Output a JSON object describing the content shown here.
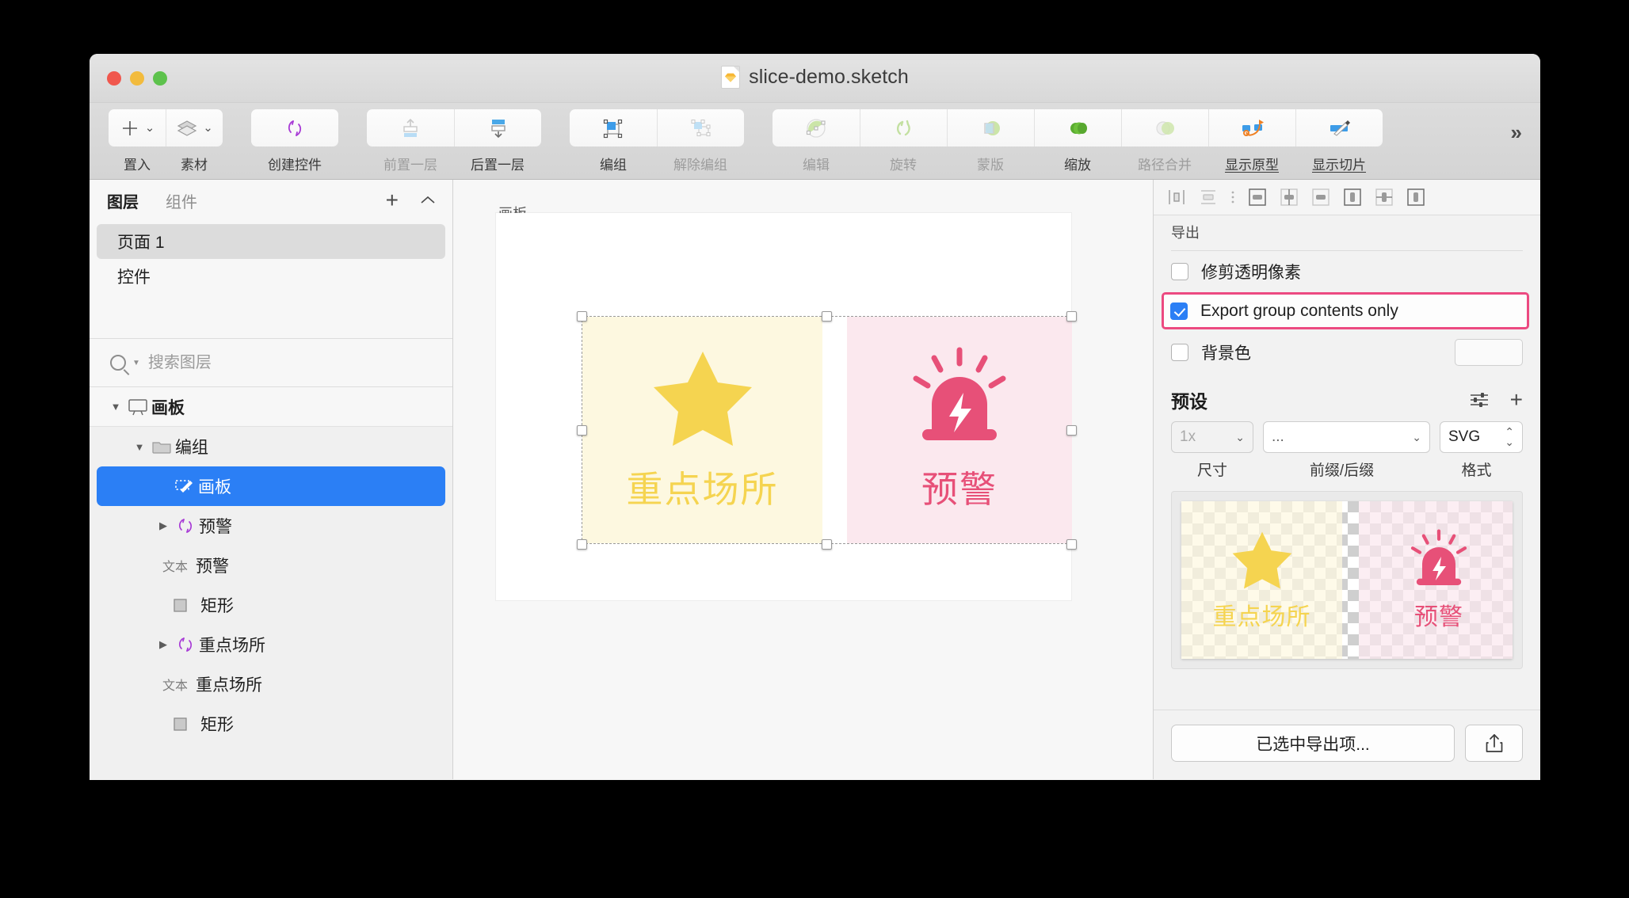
{
  "window": {
    "title": "slice-demo.sketch",
    "file_icon": "sketch-file-icon"
  },
  "toolbar": {
    "groups": [
      {
        "items": [
          {
            "label": "置入",
            "icon": "plus-icon",
            "dim": false,
            "underline": false,
            "chevron": true
          },
          {
            "label": "素材",
            "icon": "layers-stack-icon",
            "dim": false,
            "underline": false,
            "chevron": true
          }
        ]
      },
      {
        "items": [
          {
            "label": "创建控件",
            "icon": "symbol-refresh-icon",
            "dim": false,
            "underline": false,
            "chevron": false
          }
        ]
      },
      {
        "items": [
          {
            "label": "前置一层",
            "icon": "bring-forward-icon",
            "dim": true,
            "underline": false,
            "chevron": false
          },
          {
            "label": "后置一层",
            "icon": "send-backward-icon",
            "dim": false,
            "underline": false,
            "chevron": false
          }
        ]
      },
      {
        "items": [
          {
            "label": "编组",
            "icon": "group-icon",
            "dim": false,
            "underline": false,
            "chevron": false
          },
          {
            "label": "解除编组",
            "icon": "ungroup-icon",
            "dim": true,
            "underline": false,
            "chevron": false
          }
        ]
      },
      {
        "items": [
          {
            "label": "编辑",
            "icon": "edit-path-icon",
            "dim": true,
            "underline": false,
            "chevron": false
          },
          {
            "label": "旋转",
            "icon": "rotate-copies-icon",
            "dim": true,
            "underline": false,
            "chevron": false
          },
          {
            "label": "蒙版",
            "icon": "mask-icon",
            "dim": true,
            "underline": false,
            "chevron": false
          },
          {
            "label": "缩放",
            "icon": "scale-icon",
            "dim": false,
            "underline": false,
            "chevron": false
          },
          {
            "label": "路径合并",
            "icon": "union-paths-icon",
            "dim": true,
            "underline": false,
            "chevron": false
          },
          {
            "label": "显示原型",
            "icon": "prototype-icon",
            "dim": false,
            "underline": true,
            "chevron": false
          },
          {
            "label": "显示切片",
            "icon": "slice-knife-icon",
            "dim": false,
            "underline": true,
            "chevron": false
          }
        ]
      }
    ],
    "overflow": "»"
  },
  "left_panel": {
    "tabs": [
      {
        "label": "图层",
        "active": true
      },
      {
        "label": "组件",
        "active": false
      }
    ],
    "add_icon": "plus-icon",
    "collapse_icon": "chevron-up-icon",
    "pages": [
      {
        "label": "页面 1",
        "selected": true
      },
      {
        "label": "控件",
        "selected": false
      }
    ],
    "search": {
      "placeholder": "搜索图层",
      "value": "",
      "icon": "search-icon"
    },
    "layers": [
      {
        "label": "画板",
        "indent": 0,
        "disclosure": "open",
        "icon": "artboard-icon",
        "badge": "",
        "selected": false,
        "header": true
      },
      {
        "label": "编组",
        "indent": 1,
        "disclosure": "open",
        "icon": "folder-icon",
        "badge": "",
        "selected": false,
        "header": false
      },
      {
        "label": "画板",
        "indent": 2,
        "disclosure": "none",
        "icon": "slice-icon",
        "badge": "",
        "selected": true,
        "header": false
      },
      {
        "label": "预警",
        "indent": 2,
        "disclosure": "closed",
        "icon": "symbol-icon",
        "badge": "",
        "selected": false,
        "header": false
      },
      {
        "label": "预警",
        "indent": 3,
        "disclosure": "none",
        "icon": "text-badge",
        "badge": "文本",
        "selected": false,
        "header": false
      },
      {
        "label": "矩形",
        "indent": 3,
        "disclosure": "none",
        "icon": "rectangle-icon",
        "badge": "",
        "selected": false,
        "header": false
      },
      {
        "label": "重点场所",
        "indent": 2,
        "disclosure": "closed",
        "icon": "symbol-icon",
        "badge": "",
        "selected": false,
        "header": false
      },
      {
        "label": "重点场所",
        "indent": 3,
        "disclosure": "none",
        "icon": "text-badge",
        "badge": "文本",
        "selected": false,
        "header": false
      },
      {
        "label": "矩形",
        "indent": 3,
        "disclosure": "none",
        "icon": "rectangle-icon",
        "badge": "",
        "selected": false,
        "header": false
      }
    ]
  },
  "canvas": {
    "artboard_label": "画板",
    "cards": [
      {
        "caption": "重点场所",
        "icon": "star-icon",
        "bg": "#fdf8e0",
        "fg": "#f5d450"
      },
      {
        "caption": "预警",
        "icon": "alarm-icon",
        "bg": "#fbe8ee",
        "fg": "#e75078"
      }
    ]
  },
  "inspector": {
    "align_icons": [
      "align-left-icon",
      "align-top-icon",
      "more-align-icon",
      "pin-top-icon",
      "pin-vertical-center-icon",
      "pin-bottom-icon",
      "pin-left-icon",
      "pin-horizontal-center-icon",
      "pin-right-icon"
    ],
    "export_section_title": "导出",
    "checkboxes": [
      {
        "label": "修剪透明像素",
        "checked": false,
        "highlighted": false,
        "has_swatch": false
      },
      {
        "label": "Export group contents only",
        "checked": true,
        "highlighted": true,
        "has_swatch": false
      },
      {
        "label": "背景色",
        "checked": false,
        "highlighted": false,
        "has_swatch": true
      }
    ],
    "highlight_color": "#ec4a81",
    "accent_color": "#2b7ff5",
    "presets": {
      "title": "预设",
      "settings_icon": "sliders-icon",
      "add_icon": "plus-icon",
      "size_value": "1x",
      "affix_value": "...",
      "format_value": "SVG",
      "labels": {
        "size": "尺寸",
        "affix": "前缀/后缀",
        "format": "格式"
      }
    },
    "preview": {
      "cards": [
        {
          "caption": "重点场所",
          "icon": "star-icon",
          "fg": "#f5d450"
        },
        {
          "caption": "预警",
          "icon": "alarm-icon",
          "fg": "#e75078"
        }
      ]
    },
    "export_button": "已选中导出项...",
    "share_icon": "share-up-icon"
  }
}
